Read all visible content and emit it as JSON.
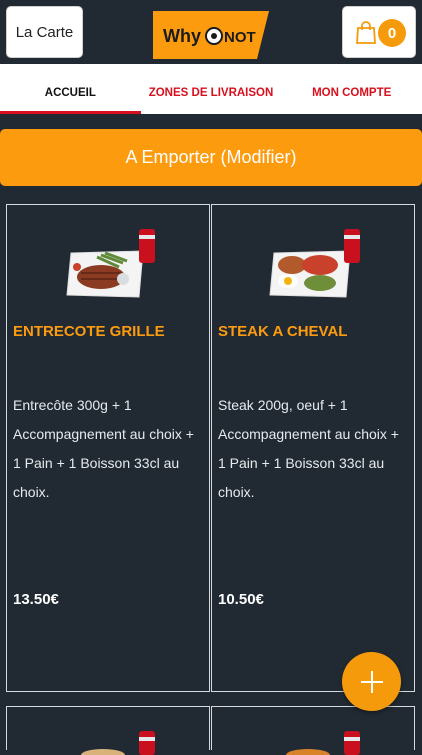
{
  "header": {
    "menu_label": "La Carte",
    "logo_text": "WhyNot",
    "cart_count": "0"
  },
  "tabs": [
    {
      "label": "ACCUEIL",
      "active": true
    },
    {
      "label": "ZONES DE LIVRAISON",
      "active": false
    },
    {
      "label": "MON COMPTE",
      "active": false
    }
  ],
  "order_mode_label": "A Emporter (Modifier)",
  "products": [
    {
      "name": "ENTRECOTE GRILLE",
      "description": "Entrecôte 300g + 1 Accompagnement au choix + 1 Pain + 1 Boisson 33cl au choix.",
      "price": "13.50€",
      "image_icon": "steak-dish-with-cola-image"
    },
    {
      "name": "STEAK A CHEVAL",
      "description": "Steak 200g, oeuf + 1 Accompagnement au choix + 1 Pain + 1 Boisson 33cl au choix.",
      "price": "10.50€",
      "image_icon": "steak-egg-dish-with-cola-image"
    }
  ],
  "colors": {
    "background": "#212a33",
    "accent": "#fd9b0f",
    "tab_red": "#d8101e"
  }
}
